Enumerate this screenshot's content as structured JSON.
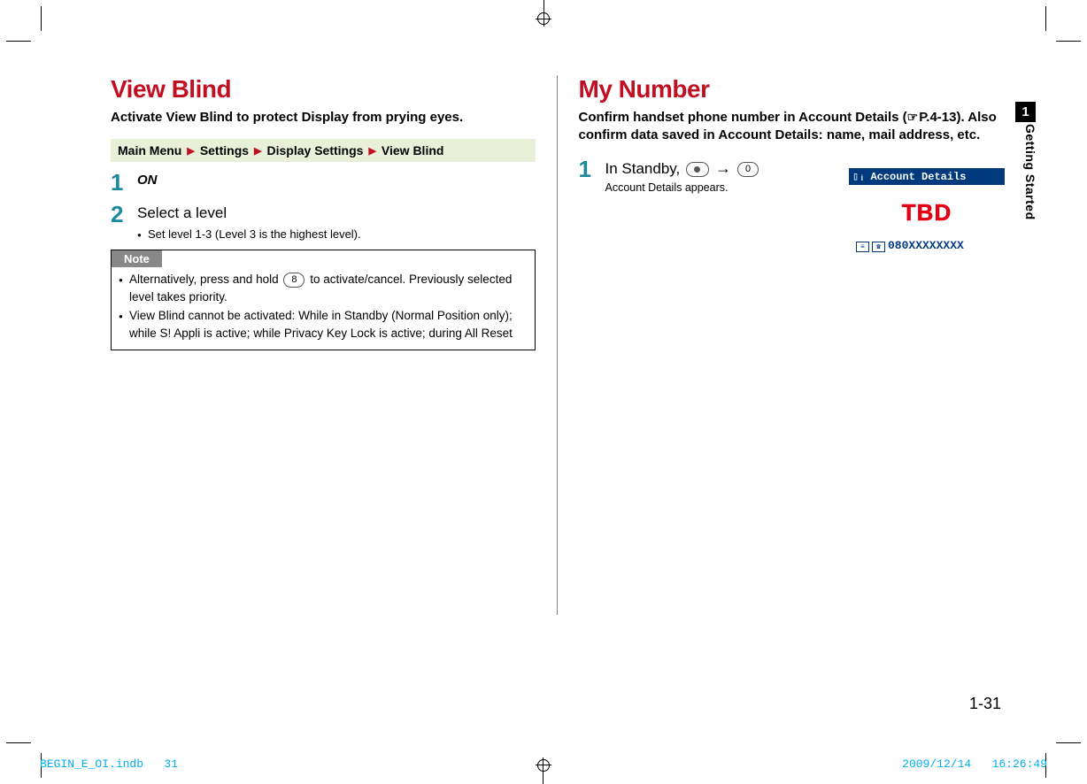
{
  "left": {
    "heading": "View Blind",
    "subheading": "Activate View Blind to protect Display from prying eyes.",
    "menu_path": [
      "Main Menu",
      "Settings",
      "Display Settings",
      "View Blind"
    ],
    "step1_label": "ON",
    "step2_label": "Select a level",
    "step2_sub": "Set level 1-3 (Level 3 is the highest level).",
    "note_label": "Note",
    "note1_pre": "Alternatively, press and hold ",
    "note1_key": "8",
    "note1_post": " to activate/cancel. Previously selected level takes priority.",
    "note2": "View Blind cannot be activated: While in Standby (Normal Position only); while S! Appli is active; while Privacy Key Lock is active; during All Reset"
  },
  "right": {
    "heading": "My Number",
    "subheading_pre": "Confirm handset phone number in Account Details (",
    "subheading_ref": "P.4-13",
    "subheading_post": "). Also confirm data saved in Account Details: name, mail address, etc.",
    "step1_pre": "In Standby, ",
    "step1_key2": "0",
    "step1_caption": "Account Details appears.",
    "screen": {
      "title": "Account Details",
      "placeholder": "TBD",
      "number": "080XXXXXXXX"
    }
  },
  "side": {
    "chapter_num": "1",
    "chapter_title": "Getting Started"
  },
  "page_number": "1-31",
  "footer": {
    "left": "BEGIN_E_OI.indb   31",
    "right": "2009/12/14   16:26:49"
  }
}
